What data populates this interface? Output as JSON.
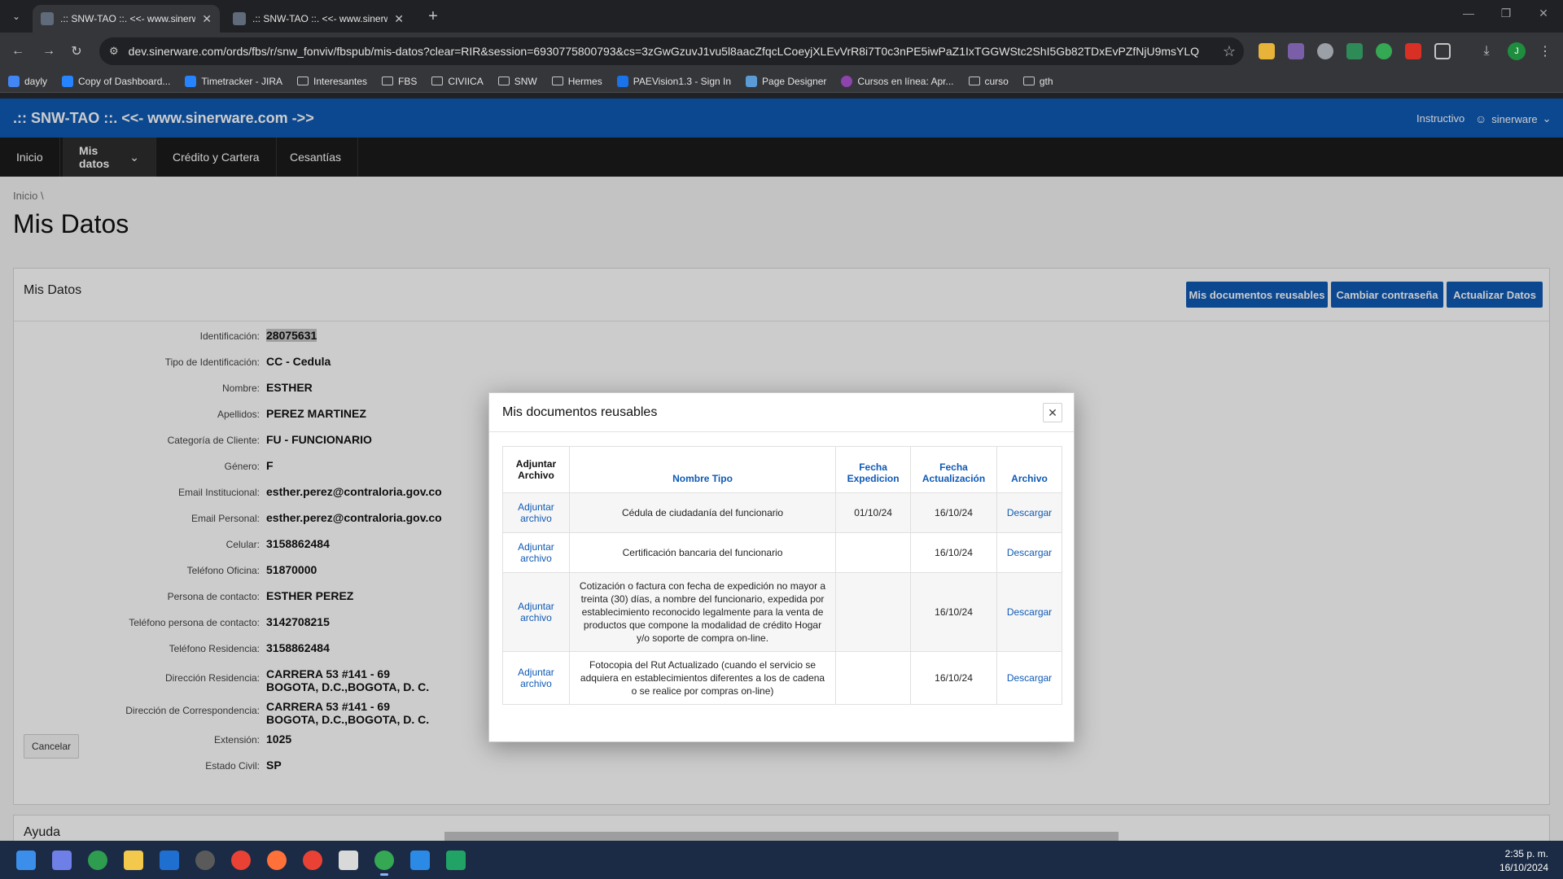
{
  "browser": {
    "tabs": [
      {
        "title": ".:: SNW-TAO ::. <<- www.sinerw",
        "active": true
      },
      {
        "title": ".:: SNW-TAO ::. <<- www.sinerw",
        "active": false
      }
    ],
    "url": "dev.sinerware.com/ords/fbs/r/snw_fonviv/fbspub/mis-datos?clear=RIR&session=6930775800793&cs=3zGwGzuvJ1vu5l8aacZfqcLCoeyjXLEvVrR8i7T0c3nPE5iwPaZ1IxTGGWStc2ShI5Gb82TDxEvPZfNjU9msYLQ",
    "profile_initial": "J",
    "bookmarks": [
      "dayly",
      "Copy of Dashboard...",
      "Timetracker - JIRA",
      "Interesantes",
      "FBS",
      "CIVIICA",
      "SNW",
      "Hermes",
      "PAEVision1.3 - Sign In",
      "Page Designer",
      "Cursos en línea: Apr...",
      "curso",
      "gth"
    ]
  },
  "app": {
    "brand": ".:: SNW-TAO ::. <<- www.sinerware.com ->>",
    "instructivo": "Instructivo",
    "user": "sinerware",
    "menu": [
      "Inicio",
      "Mis datos",
      "Crédito y Cartera",
      "Cesantías"
    ],
    "breadcrumb": "Inicio \\",
    "page_title": "Mis Datos"
  },
  "region": {
    "title": "Mis Datos",
    "buttons": {
      "reusables": "Mis documentos reusables",
      "password": "Cambiar contraseña",
      "update": "Actualizar Datos"
    },
    "cancel": "Cancelar",
    "fields": [
      {
        "label": "Identificación:",
        "value": "28075631"
      },
      {
        "label": "Tipo de Identificación:",
        "value": "CC - Cedula"
      },
      {
        "label": "Nombre:",
        "value": "ESTHER"
      },
      {
        "label": "Apellidos:",
        "value": "PEREZ MARTINEZ"
      },
      {
        "label": "Categoría de Cliente:",
        "value": "FU - FUNCIONARIO"
      },
      {
        "label": "Género:",
        "value": "F"
      },
      {
        "label": "Email Institucional:",
        "value": "esther.perez@contraloria.gov.co"
      },
      {
        "label": "Email Personal:",
        "value": "esther.perez@contraloria.gov.co"
      },
      {
        "label": "Celular:",
        "value": "3158862484"
      },
      {
        "label": "Teléfono Oficina:",
        "value": "51870000"
      },
      {
        "label": "Persona de contacto:",
        "value": "ESTHER PEREZ"
      },
      {
        "label": "Teléfono persona de contacto:",
        "value": "3142708215"
      },
      {
        "label": "Teléfono Residencia:",
        "value": "3158862484"
      },
      {
        "label": "Dirección Residencia:",
        "value": "CARRERA 53 #141 - 69",
        "value2": "BOGOTA, D.C.,BOGOTA, D. C."
      },
      {
        "label": "Dirección de Correspondencia:",
        "value": "CARRERA 53 #141 - 69",
        "value2": "BOGOTA, D.C.,BOGOTA, D. C."
      },
      {
        "label": "Extensión:",
        "value": "1025"
      },
      {
        "label": "Estado Civil:",
        "value": "SP"
      }
    ]
  },
  "help": {
    "title": "Ayuda"
  },
  "dialog": {
    "title": "Mis documentos reusables",
    "headers": [
      "Adjuntar Archivo",
      "Nombre Tipo",
      "Fecha Expedicion",
      "Fecha Actualización",
      "Archivo"
    ],
    "rows": [
      {
        "attach": "Adjuntar archivo",
        "name": "Cédula de ciudadanía del funcionario",
        "expedicion": "01/10/24",
        "actualizacion": "16/10/24",
        "archivo": "Descargar"
      },
      {
        "attach": "Adjuntar archivo",
        "name": "Certificación bancaria del funcionario",
        "expedicion": "",
        "actualizacion": "16/10/24",
        "archivo": "Descargar"
      },
      {
        "attach": "Adjuntar archivo",
        "name": "Cotización o factura con fecha de expedición no mayor a treinta (30) días, a nombre del funcionario, expedida por establecimiento reconocido legalmente para la venta de productos que compone la modalidad de crédito Hogar y/o soporte de compra on-line.",
        "expedicion": "",
        "actualizacion": "16/10/24",
        "archivo": "Descargar"
      },
      {
        "attach": "Adjuntar archivo",
        "name": "Fotocopia del Rut Actualizado (cuando el servicio se adquiera en establecimientos diferentes a los de cadena o se realice por compras on-line)",
        "expedicion": "",
        "actualizacion": "16/10/24",
        "archivo": "Descargar"
      }
    ]
  },
  "taskbar": {
    "time": "2:35 p. m.",
    "date": "16/10/2024"
  },
  "colors": {
    "brand_blue": "#0f5ab4",
    "menu_bg": "#1b1b1b"
  }
}
